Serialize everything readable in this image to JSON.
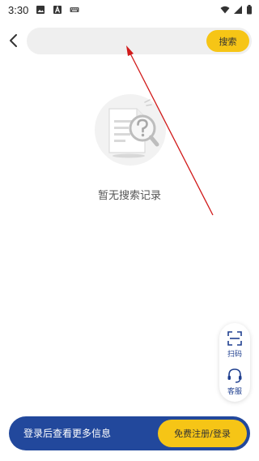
{
  "status_bar": {
    "time": "3:30",
    "notification_icons": [
      "image-icon",
      "a-letter-icon",
      "keyboard-icon"
    ],
    "system_icons": [
      "wifi-icon",
      "signal-icon",
      "battery-icon"
    ]
  },
  "header": {
    "back_icon": "chevron-left-icon",
    "search": {
      "value": "",
      "placeholder": "",
      "button_label": "搜索"
    }
  },
  "empty_state": {
    "icon": "search-document-icon",
    "message": "暂无搜索记录"
  },
  "float_panel": {
    "items": [
      {
        "icon": "scan-icon",
        "label": "扫码"
      },
      {
        "icon": "headset-icon",
        "label": "客服"
      }
    ]
  },
  "login_bar": {
    "message": "登录后查看更多信息",
    "button_label": "免费注册/登录"
  },
  "colors": {
    "accent_yellow": "#f6c516",
    "brand_blue": "#22489c",
    "search_bg": "#efefef",
    "annotation_red": "#d11a1a"
  }
}
